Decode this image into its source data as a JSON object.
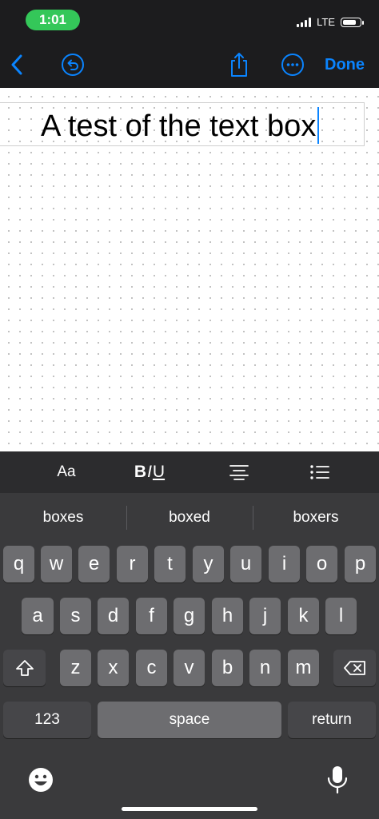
{
  "status": {
    "time": "1:01",
    "network": "LTE",
    "time_pill_color": "#34c759"
  },
  "toolbar": {
    "done_label": "Done",
    "accent": "#0a84ff"
  },
  "canvas": {
    "text_box_content": "A test of the text box"
  },
  "format_bar": {
    "font_label": "Aa",
    "bold": "B",
    "italic": "I",
    "underline": "U"
  },
  "suggestions": [
    "boxes",
    "boxed",
    "boxers"
  ],
  "keyboard": {
    "row1": [
      "q",
      "w",
      "e",
      "r",
      "t",
      "y",
      "u",
      "i",
      "o",
      "p"
    ],
    "row2": [
      "a",
      "s",
      "d",
      "f",
      "g",
      "h",
      "j",
      "k",
      "l"
    ],
    "row3": [
      "z",
      "x",
      "c",
      "v",
      "b",
      "n",
      "m"
    ],
    "numbers_label": "123",
    "space_label": "space",
    "return_label": "return"
  }
}
